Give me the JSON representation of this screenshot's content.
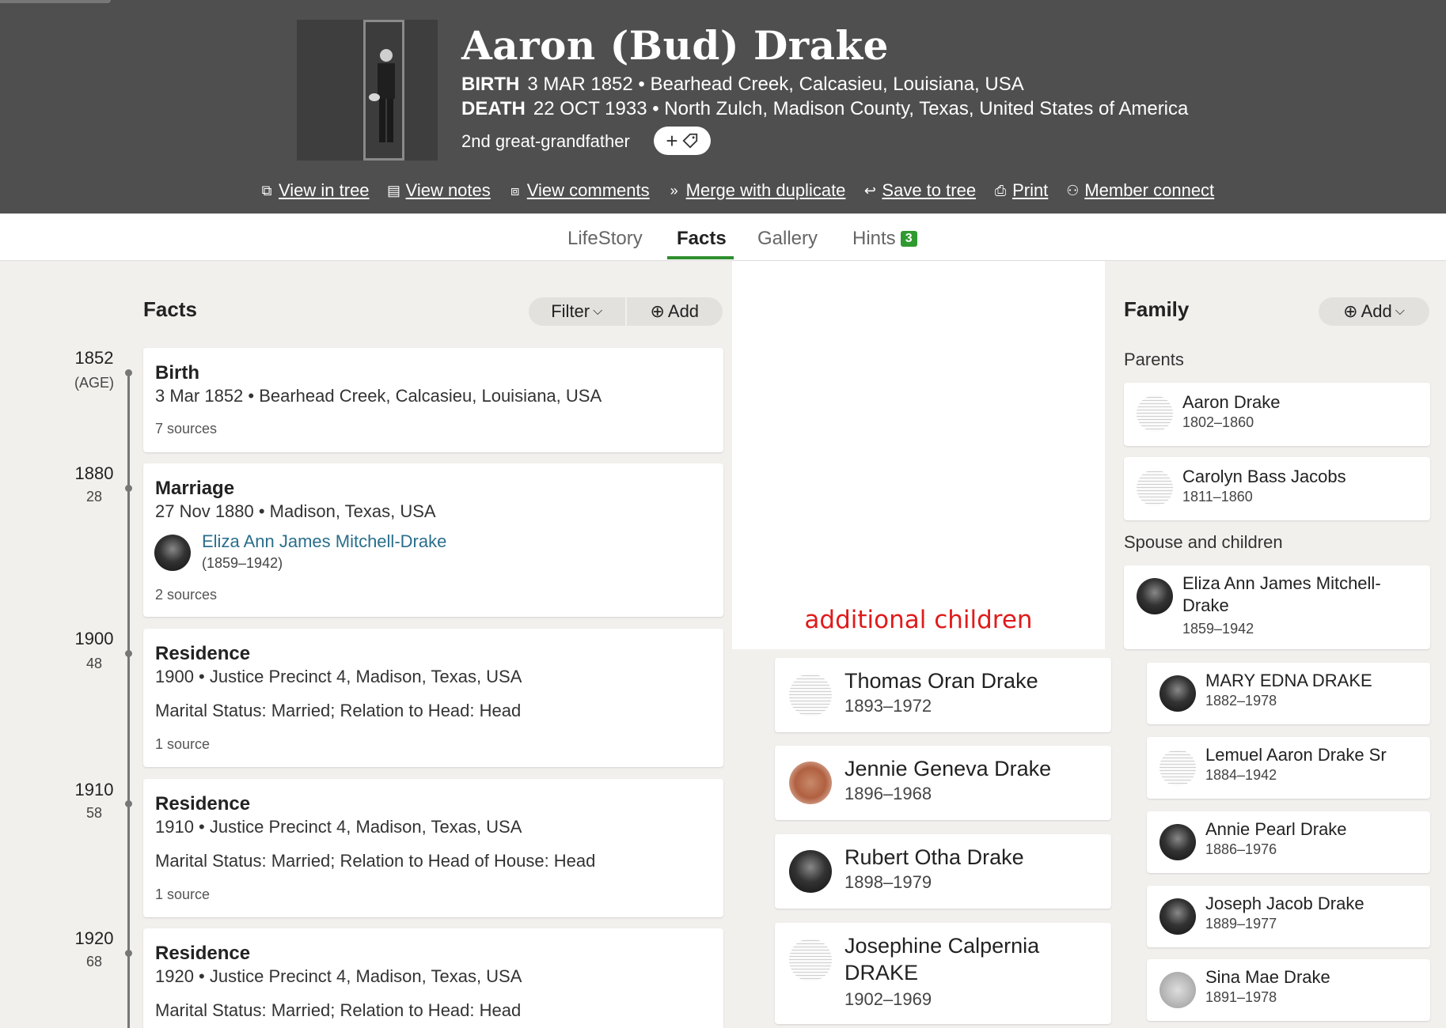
{
  "person": {
    "name": "Aaron (Bud) Drake",
    "birth_label": "BIRTH",
    "birth_value": "3 MAR 1852 • Bearhead Creek, Calcasieu, Louisiana, USA",
    "death_label": "DEATH",
    "death_value": "22 OCT 1933 • North Zulch, Madison County, Texas, United States of America",
    "relationship": "2nd great-grandfather",
    "tag_button": "+"
  },
  "actions": [
    {
      "label": "View in tree",
      "icon": "tree-icon"
    },
    {
      "label": "View notes",
      "icon": "notes-icon"
    },
    {
      "label": "View comments",
      "icon": "comments-icon"
    },
    {
      "label": "Merge with duplicate",
      "icon": "merge-icon"
    },
    {
      "label": "Save to tree",
      "icon": "save-icon"
    },
    {
      "label": "Print",
      "icon": "print-icon"
    },
    {
      "label": "Member connect",
      "icon": "members-icon"
    }
  ],
  "tabs": [
    {
      "label": "LifeStory"
    },
    {
      "label": "Facts",
      "active": true
    },
    {
      "label": "Gallery"
    },
    {
      "label": "Hints",
      "badge": "3"
    }
  ],
  "facts": {
    "title": "Facts",
    "filter_label": "Filter",
    "add_label": "Add",
    "items": [
      {
        "year": "1852",
        "age": "(AGE)",
        "title": "Birth",
        "line1": "3 Mar 1852 • Bearhead Creek, Calcasieu, Louisiana, USA",
        "sources": "7 sources"
      },
      {
        "year": "1880",
        "age": "28",
        "title": "Marriage",
        "line1": "27 Nov 1880 • Madison, Texas, USA",
        "spouse_name": "Eliza Ann James Mitchell-Drake",
        "spouse_dates": "(1859–1942)",
        "sources": "2 sources"
      },
      {
        "year": "1900",
        "age": "48",
        "title": "Residence",
        "line1": "1900 • Justice Precinct 4, Madison, Texas, USA",
        "line2": "Marital Status: Married; Relation to Head: Head",
        "sources": "1 source"
      },
      {
        "year": "1910",
        "age": "58",
        "title": "Residence",
        "line1": "1910 • Justice Precinct 4, Madison, Texas, USA",
        "line2": "Marital Status: Married; Relation to Head of House: Head",
        "sources": "1 source"
      },
      {
        "year": "1920",
        "age": "68",
        "title": "Residence",
        "line1": "1920 • Justice Precinct 4, Madison, Texas, USA",
        "line2": "Marital Status: Married; Relation to Head: Head"
      }
    ]
  },
  "overlay_note": "additional children",
  "additional_children": [
    {
      "name": "Thomas Oran Drake",
      "dates": "1893–1972"
    },
    {
      "name": "Jennie Geneva Drake",
      "dates": "1896–1968"
    },
    {
      "name": "Rubert Otha Drake",
      "dates": "1898–1979"
    },
    {
      "name_line1": "Josephine Calpernia",
      "name_line2": "DRAKE",
      "dates": "1902–1969"
    }
  ],
  "family": {
    "title": "Family",
    "add_label": "Add",
    "parents_label": "Parents",
    "parents": [
      {
        "name": "Aaron Drake",
        "dates": "1802–1860"
      },
      {
        "name": "Carolyn Bass Jacobs",
        "dates": "1811–1860"
      }
    ],
    "spouse_label": "Spouse and children",
    "spouse": {
      "name_line1": "Eliza Ann James Mitchell-",
      "name_line2": "Drake",
      "dates": "1859–1942"
    },
    "children": [
      {
        "name": "MARY EDNA DRAKE",
        "dates": "1882–1978"
      },
      {
        "name": "Lemuel Aaron Drake Sr",
        "dates": "1884–1942"
      },
      {
        "name": "Annie Pearl Drake",
        "dates": "1886–1976"
      },
      {
        "name": "Joseph Jacob Drake",
        "dates": "1889–1977"
      },
      {
        "name": "Sina Mae Drake",
        "dates": "1891–1978"
      }
    ]
  },
  "colors": {
    "header_bg": "#4f4f4f",
    "page_bg": "#f2f0ed",
    "active_tab": "#2f8f2f",
    "link": "#2a6e8c",
    "annotation": "#e01b1b"
  }
}
